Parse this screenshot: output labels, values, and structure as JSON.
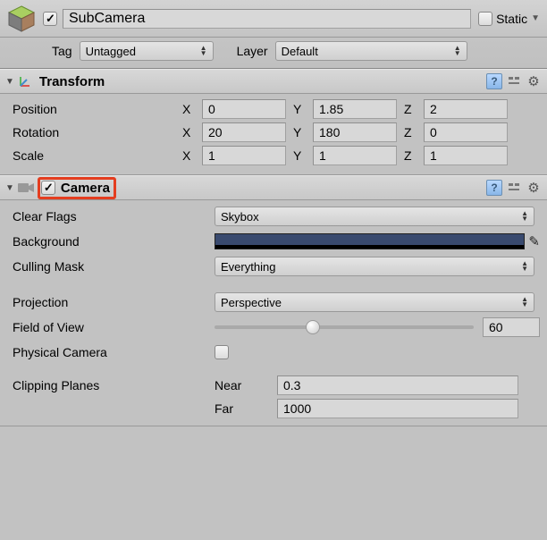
{
  "header": {
    "object_name": "SubCamera",
    "static_label": "Static",
    "active_checked": true,
    "static_checked": false
  },
  "tag_row": {
    "tag_label": "Tag",
    "tag_value": "Untagged",
    "layer_label": "Layer",
    "layer_value": "Default"
  },
  "transform": {
    "title": "Transform",
    "rows": {
      "position": {
        "label": "Position",
        "x": "0",
        "y": "1.85",
        "z": "2"
      },
      "rotation": {
        "label": "Rotation",
        "x": "20",
        "y": "180",
        "z": "0"
      },
      "scale": {
        "label": "Scale",
        "x": "1",
        "y": "1",
        "z": "1"
      }
    },
    "axis_labels": {
      "x": "X",
      "y": "Y",
      "z": "Z"
    }
  },
  "camera": {
    "title": "Camera",
    "enabled": true,
    "clear_flags_label": "Clear Flags",
    "clear_flags_value": "Skybox",
    "background_label": "Background",
    "background_color": "#394a6f",
    "culling_label": "Culling Mask",
    "culling_value": "Everything",
    "projection_label": "Projection",
    "projection_value": "Perspective",
    "fov_label": "Field of View",
    "fov_value": "60",
    "physical_label": "Physical Camera",
    "physical_checked": false,
    "clipping_label": "Clipping Planes",
    "near_label": "Near",
    "near_value": "0.3",
    "far_label": "Far",
    "far_value": "1000"
  }
}
